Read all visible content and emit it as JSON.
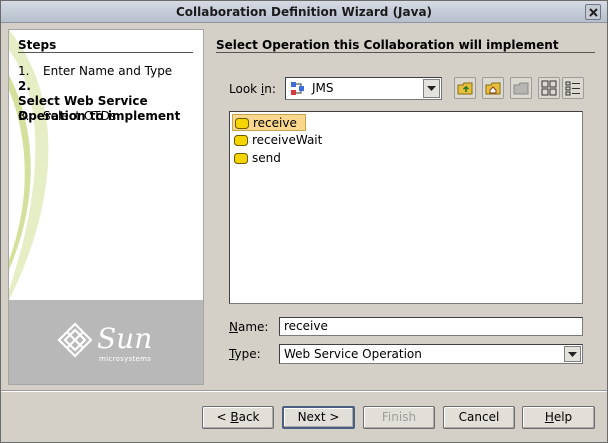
{
  "window": {
    "title": "Collaboration Definition Wizard (Java)"
  },
  "steps": {
    "heading": "Steps",
    "items": [
      {
        "num": "1.",
        "line1": "Enter Name and Type",
        "line2": ""
      },
      {
        "num": "2.",
        "line1": "Select Web Service",
        "line2": "Operation to implement"
      },
      {
        "num": "3.",
        "line1": "Select OTDs",
        "line2": ""
      }
    ]
  },
  "brand": {
    "name": "Sun",
    "sub": "microsystems"
  },
  "content": {
    "heading": "Select Operation this Collaboration will implement",
    "look_in": {
      "label_pre": "Look ",
      "label_key": "i",
      "label_post": "n:",
      "value": "JMS"
    },
    "files": [
      "receive",
      "receiveWait",
      "send"
    ],
    "name": {
      "label_key": "N",
      "label_post": "ame:",
      "value": "receive"
    },
    "type": {
      "label_key": "T",
      "label_post": "ype:",
      "value": "Web Service Operation"
    }
  },
  "buttons": {
    "back": {
      "pre": "< ",
      "key": "B",
      "post": "ack"
    },
    "next": "Next >",
    "finish": "Finish",
    "cancel": "Cancel",
    "help": {
      "key": "H",
      "post": "elp"
    }
  },
  "colors": {
    "selection": "#f9d88e",
    "folder": "#f5d400",
    "dialog": "#d4d0c8"
  }
}
